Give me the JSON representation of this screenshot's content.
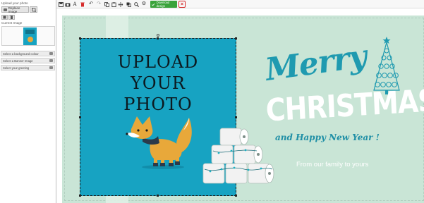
{
  "left_panel": {
    "upload_heading": "Upload your photo",
    "replace_label": "Replace Image",
    "current_image_label": "Current Image",
    "sections": [
      {
        "label": "Select a background colour"
      },
      {
        "label": "Select a Banner Image"
      },
      {
        "label": "Select your greeting"
      }
    ]
  },
  "toolbar": {
    "tools": [
      {
        "icon": "save-icon"
      },
      {
        "icon": "camera-icon"
      },
      {
        "icon": "text-icon"
      },
      {
        "icon": "delete-icon"
      },
      {
        "icon": "undo-icon"
      },
      {
        "icon": "redo-icon"
      },
      {
        "icon": "copy-icon"
      },
      {
        "icon": "paste-icon"
      },
      {
        "icon": "align-icon"
      },
      {
        "icon": "layers-icon"
      },
      {
        "icon": "zoom-icon"
      },
      {
        "icon": "settings-icon"
      }
    ],
    "download_label": "Download design"
  },
  "card": {
    "placeholder_lines": [
      "UPLOAD",
      "YOUR",
      "PHOTO"
    ],
    "merry": "Merry",
    "christmas": "CHRISTMAS",
    "happy_new_year": "and Happy New Year !",
    "family_line": "From our family to yours"
  },
  "colors": {
    "card_background": "#c9e5d6",
    "photo_background": "#17a3c2",
    "accent_teal": "#1f9ab0",
    "download_green": "#3aa33b",
    "close_red": "#d62b2b"
  }
}
